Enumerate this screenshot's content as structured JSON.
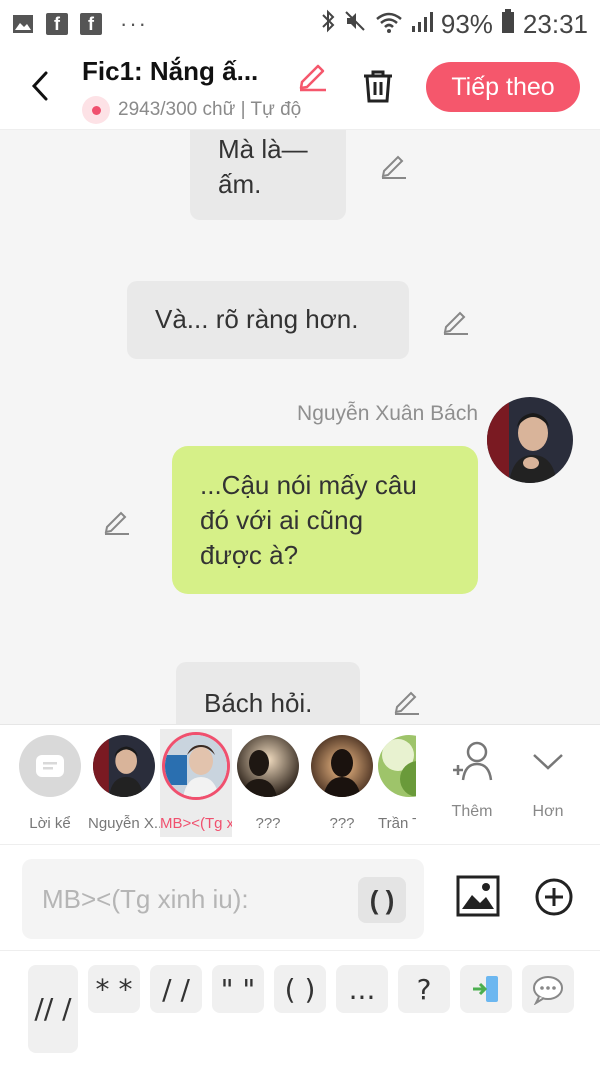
{
  "status": {
    "battery": "93%",
    "time": "23:31",
    "more": "···"
  },
  "header": {
    "title": "Fic1: Nắng ấ...",
    "subtitle": "2943/300 chữ | Tự độ",
    "next_label": "Tiếp theo"
  },
  "messages": [
    {
      "text_l1": "Mà là—",
      "text_l2": "ấm."
    },
    {
      "text": "Và... rõ ràng hơn."
    },
    {
      "sender": "Nguyễn Xuân Bách",
      "l1": "...Cậu nói mấy câu",
      "l2": "đó với ai cũng",
      "l3": "được à?"
    },
    {
      "text": "Bách hỏi."
    }
  ],
  "characters": [
    {
      "label": "Lời kể"
    },
    {
      "label": "Nguyễn X..."
    },
    {
      "label": "MB><(Tg x..."
    },
    {
      "label": "???"
    },
    {
      "label": "???"
    },
    {
      "label": "Trần T"
    }
  ],
  "controls": {
    "add_label": "Thêm",
    "more_label": "Hơn"
  },
  "input": {
    "placeholder": "MB><(Tg xinh iu):",
    "paren": "( )"
  },
  "shortcuts": [
    {
      "label": "// /"
    },
    {
      "label": "* *"
    },
    {
      "label": "/ /"
    },
    {
      "label": "\" \""
    },
    {
      "label": "( )"
    },
    {
      "label": "..."
    },
    {
      "label": "?"
    }
  ],
  "colors": {
    "accent": "#f5576c",
    "green_bubble": "#d6f088",
    "grey_bubble": "#e9e9e9"
  }
}
